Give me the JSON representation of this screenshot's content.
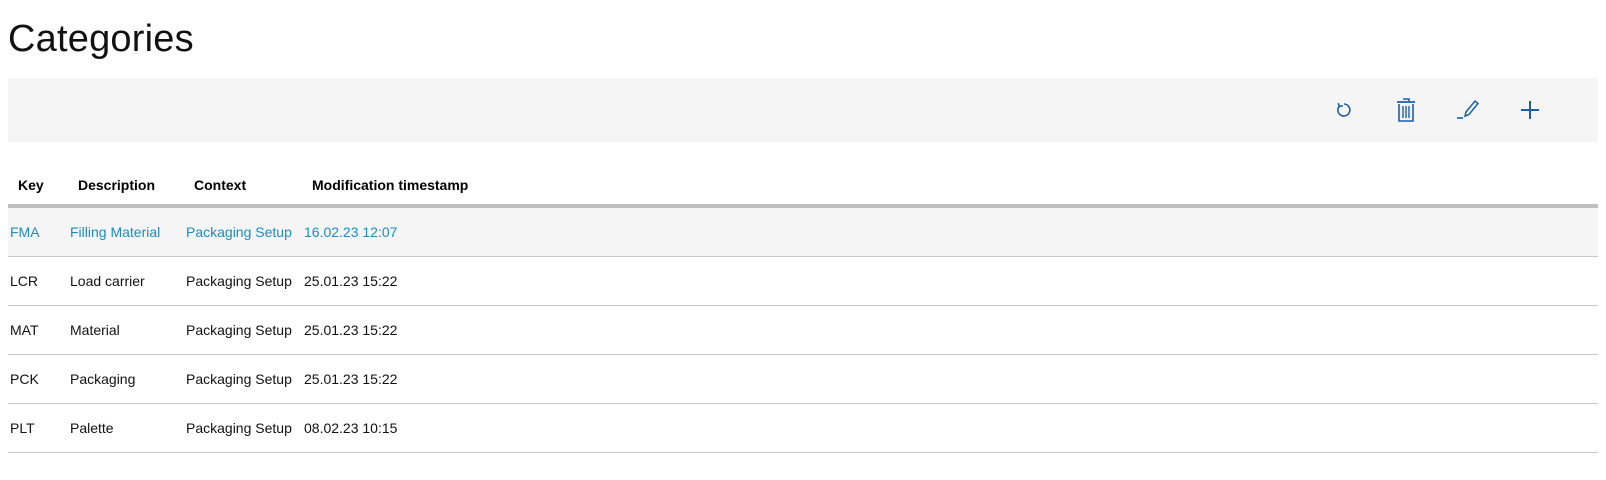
{
  "page": {
    "title": "Categories"
  },
  "toolbar": {
    "accent_color": "#1b5fa8",
    "buttons": [
      {
        "name": "refresh",
        "icon": "refresh-icon"
      },
      {
        "name": "delete",
        "icon": "trash-icon"
      },
      {
        "name": "edit",
        "icon": "pencil-icon"
      },
      {
        "name": "add",
        "icon": "plus-icon"
      }
    ]
  },
  "table": {
    "columns": [
      "Key",
      "Description",
      "Context",
      "Modification timestamp"
    ],
    "selected_row_color": "#1b8cc9",
    "rows": [
      {
        "key": "FMA",
        "description": "Filling Material",
        "context": "Packaging Setup",
        "timestamp": "16.02.23 12:07",
        "selected": true
      },
      {
        "key": "LCR",
        "description": "Load carrier",
        "context": "Packaging Setup",
        "timestamp": "25.01.23 15:22",
        "selected": false
      },
      {
        "key": "MAT",
        "description": "Material",
        "context": "Packaging Setup",
        "timestamp": "25.01.23 15:22",
        "selected": false
      },
      {
        "key": "PCK",
        "description": "Packaging",
        "context": "Packaging Setup",
        "timestamp": "25.01.23 15:22",
        "selected": false
      },
      {
        "key": "PLT",
        "description": "Palette",
        "context": "Packaging Setup",
        "timestamp": "08.02.23 10:15",
        "selected": false
      }
    ]
  }
}
